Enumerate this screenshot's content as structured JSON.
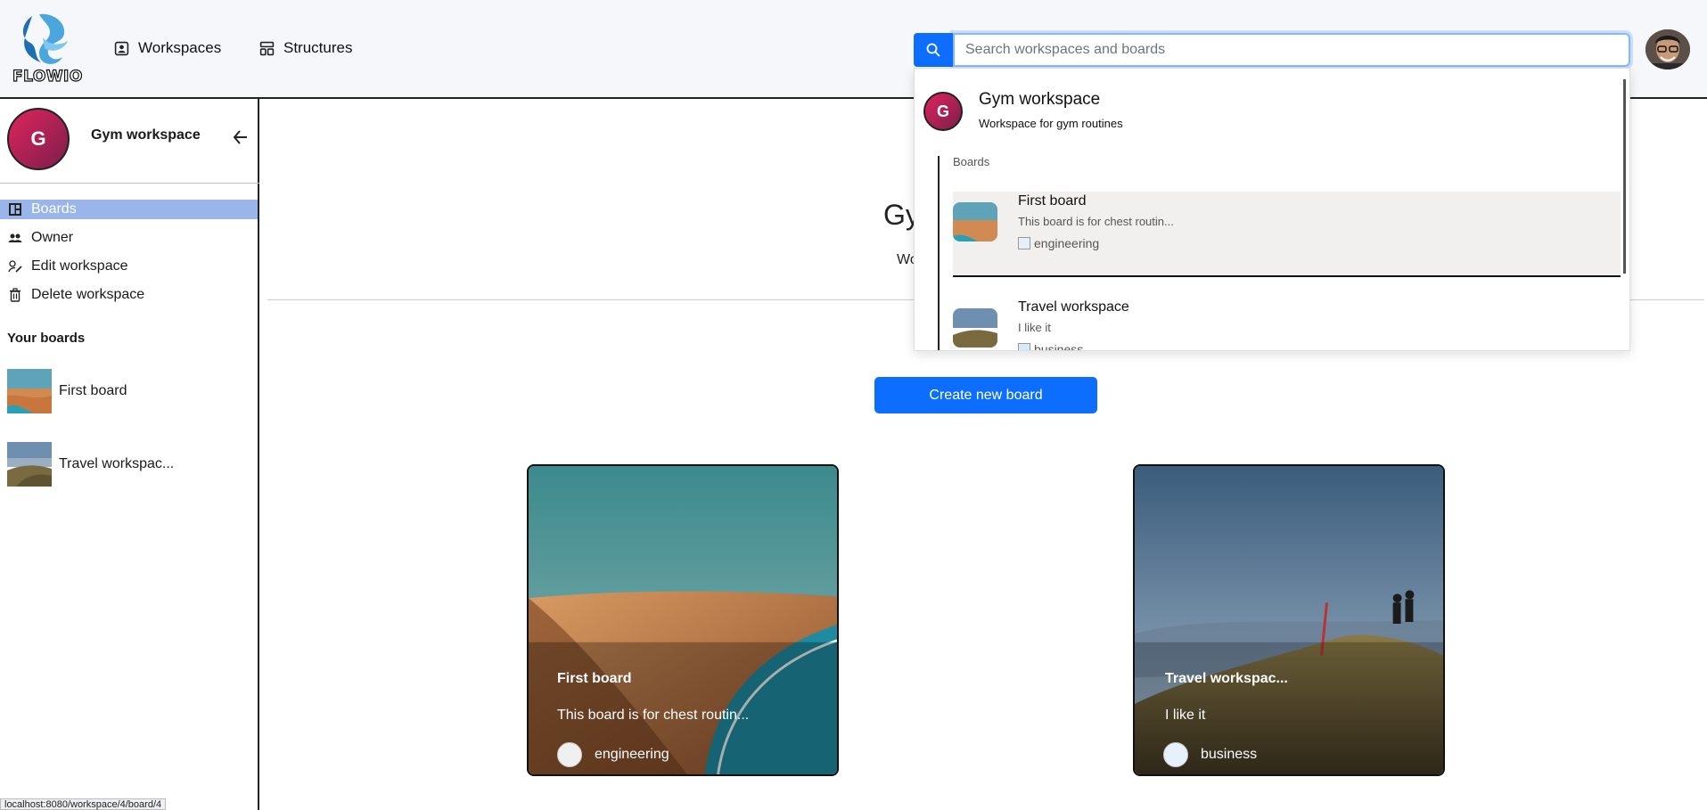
{
  "topbar": {
    "logo_text": "FLOWIO",
    "nav": [
      {
        "label": "Workspaces",
        "icon": "workspaces-icon"
      },
      {
        "label": "Structures",
        "icon": "structures-icon"
      }
    ],
    "search": {
      "placeholder": "Search workspaces and boards",
      "value": ""
    }
  },
  "sidebar": {
    "workspace_initial": "G",
    "workspace_name": "Gym workspace",
    "items": [
      {
        "label": "Boards",
        "icon": "boards-icon",
        "active": true
      },
      {
        "label": "Owner",
        "icon": "users-icon",
        "active": false
      },
      {
        "label": "Edit workspace",
        "icon": "edit-icon",
        "active": false
      },
      {
        "label": "Delete workspace",
        "icon": "trash-icon",
        "active": false
      }
    ],
    "your_boards_label": "Your boards",
    "boards": [
      {
        "label": "First board"
      },
      {
        "label": "Travel workspac..."
      }
    ]
  },
  "main": {
    "title_fragment": "Gy",
    "subtitle_fragment": "Wo",
    "create_button": "Create new board",
    "cards": [
      {
        "title": "First board",
        "desc": "This board is for chest routin...",
        "tag": "engineering"
      },
      {
        "title": "Travel workspac...",
        "desc": "I like it",
        "tag": "business"
      }
    ]
  },
  "dropdown": {
    "workspace_initial": "G",
    "workspace_name": "Gym workspace",
    "workspace_desc": "Workspace for gym routines",
    "boards_label": "Boards",
    "results": [
      {
        "title": "First board",
        "desc": "This board is for chest routin...",
        "tag": "engineering"
      },
      {
        "title": "Travel workspace",
        "desc": "I like it",
        "tag": "business"
      }
    ]
  },
  "status_bar": "localhost:8080/workspace/4/board/4",
  "colors": {
    "accent": "#0d6efd",
    "active_sidebar": "#9ab5ea",
    "workspace_avatar": "#c42a5f"
  }
}
